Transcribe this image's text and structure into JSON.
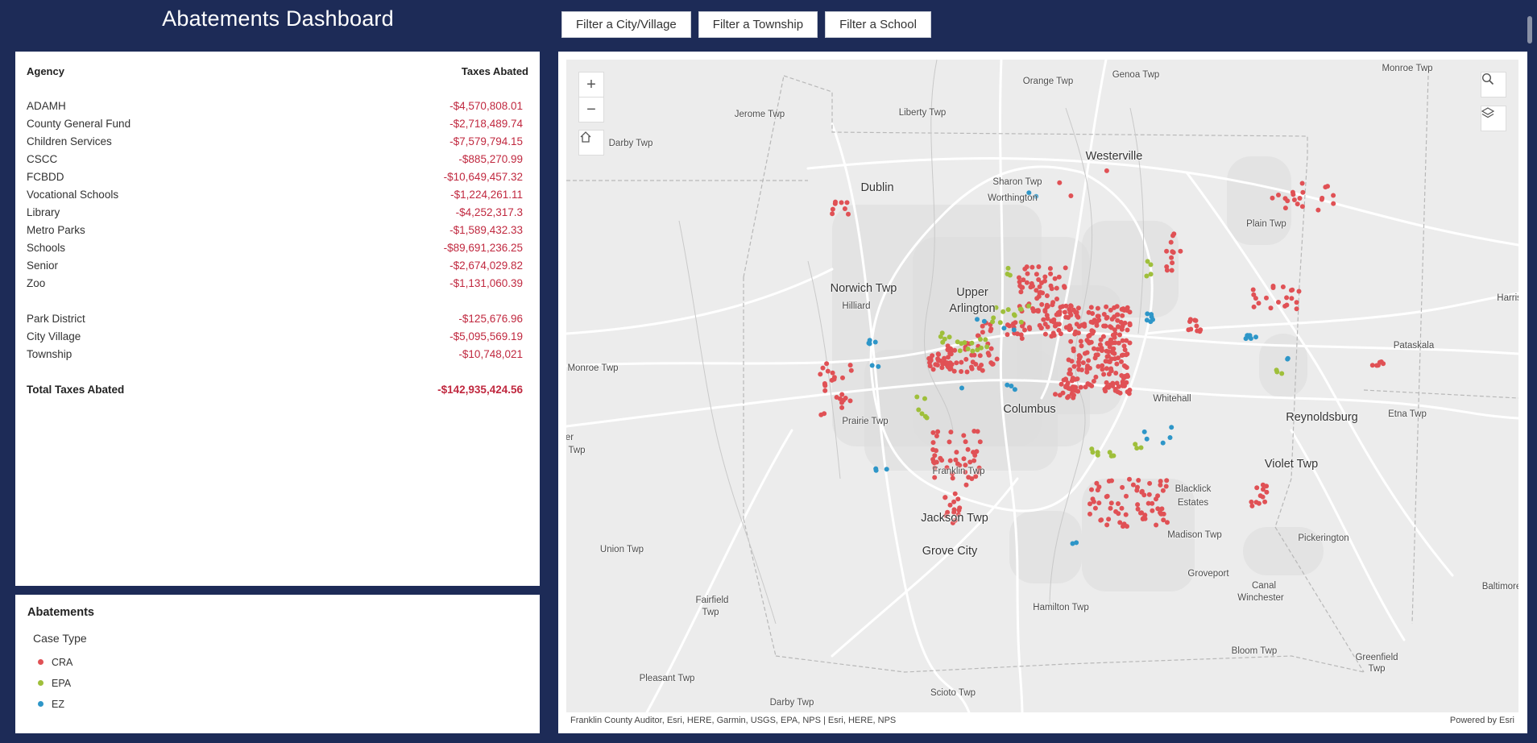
{
  "header": {
    "title": "Abatements Dashboard",
    "filters": [
      "Filter a City/Village",
      "Filter a Township",
      "Filter a School"
    ]
  },
  "table": {
    "col_agency": "Agency",
    "col_taxes": "Taxes Abated",
    "rows": [
      {
        "agency": "ADAMH",
        "amount": "-$4,570,808.01"
      },
      {
        "agency": "County General Fund",
        "amount": "-$2,718,489.74"
      },
      {
        "agency": "Children Services",
        "amount": "-$7,579,794.15"
      },
      {
        "agency": "CSCC",
        "amount": "-$885,270.99"
      },
      {
        "agency": "FCBDD",
        "amount": "-$10,649,457.32"
      },
      {
        "agency": "Vocational Schools",
        "amount": "-$1,224,261.11"
      },
      {
        "agency": "Library",
        "amount": "-$4,252,317.3"
      },
      {
        "agency": "Metro Parks",
        "amount": "-$1,589,432.33"
      },
      {
        "agency": "Schools",
        "amount": "-$89,691,236.25"
      },
      {
        "agency": "Senior",
        "amount": "-$2,674,029.82"
      },
      {
        "agency": "Zoo",
        "amount": "-$1,131,060.39"
      }
    ],
    "rows2": [
      {
        "agency": "Park District",
        "amount": "-$125,676.96"
      },
      {
        "agency": "City Village",
        "amount": "-$5,095,569.19"
      },
      {
        "agency": "Township",
        "amount": "-$10,748,021"
      }
    ],
    "total": {
      "agency": "Total Taxes Abated",
      "amount": "-$142,935,424.56"
    }
  },
  "legend": {
    "title": "Abatements",
    "subtitle": "Case Type",
    "items": [
      {
        "label": "CRA",
        "color": "#e05155"
      },
      {
        "label": "EPA",
        "color": "#9fbf3b"
      },
      {
        "label": "EZ",
        "color": "#2e96c8"
      }
    ]
  },
  "map": {
    "labels": [
      {
        "text": "Orange Twp",
        "big": false
      },
      {
        "text": "Genoa Twp",
        "big": false
      },
      {
        "text": "Monroe Twp",
        "big": false
      },
      {
        "text": "Jerome Twp",
        "big": false
      },
      {
        "text": "Liberty Twp",
        "big": false
      },
      {
        "text": "Darby Twp",
        "big": false
      },
      {
        "text": "Westerville",
        "big": true
      },
      {
        "text": "Dublin",
        "big": true
      },
      {
        "text": "Sharon Twp",
        "big": false
      },
      {
        "text": "Worthington",
        "big": false
      },
      {
        "text": "Plain Twp",
        "big": false
      },
      {
        "text": "Norwich Twp",
        "big": true
      },
      {
        "text": "Upper",
        "big": true
      },
      {
        "text": "Arlington",
        "big": true
      },
      {
        "text": "Hilliard",
        "big": false
      },
      {
        "text": "Harrison",
        "big": false
      },
      {
        "text": "Pataskala",
        "big": false
      },
      {
        "text": "Monroe Twp",
        "big": false
      },
      {
        "text": "Columbus",
        "big": true
      },
      {
        "text": "Whitehall",
        "big": false
      },
      {
        "text": "Reynoldsburg",
        "big": true
      },
      {
        "text": "Etna Twp",
        "big": false
      },
      {
        "text": "Prairie Twp",
        "big": false
      },
      {
        "text": "er",
        "big": false
      },
      {
        "text": "Twp",
        "big": false
      },
      {
        "text": "Violet Twp",
        "big": true
      },
      {
        "text": "Franklin Twp",
        "big": false
      },
      {
        "text": "Blacklick",
        "big": false
      },
      {
        "text": "Estates",
        "big": false
      },
      {
        "text": "Jackson Twp",
        "big": true
      },
      {
        "text": "Madison Twp",
        "big": false
      },
      {
        "text": "Pickerington",
        "big": false
      },
      {
        "text": "Union Twp",
        "big": false
      },
      {
        "text": "Grove City",
        "big": true
      },
      {
        "text": "Groveport",
        "big": false
      },
      {
        "text": "Canal",
        "big": false
      },
      {
        "text": "Winchester",
        "big": false
      },
      {
        "text": "Baltimore",
        "big": false
      },
      {
        "text": "Fairfield",
        "big": false
      },
      {
        "text": "Twp",
        "big": false
      },
      {
        "text": "Hamilton Twp",
        "big": false
      },
      {
        "text": "Bloom Twp",
        "big": false
      },
      {
        "text": "Greenfield",
        "big": false
      },
      {
        "text": "Twp",
        "big": false
      },
      {
        "text": "Pleasant Twp",
        "big": false
      },
      {
        "text": "Darby Twp",
        "big": false
      },
      {
        "text": "Scioto Twp",
        "big": false
      }
    ],
    "attribution": "Franklin County Auditor, Esri, HERE, Garmin, USGS, EPA, NPS | Esri, HERE, NPS",
    "powered": "Powered by Esri",
    "controls": [
      "plus-icon",
      "minus-icon",
      "home-icon",
      "search-icon",
      "layers-icon"
    ]
  }
}
